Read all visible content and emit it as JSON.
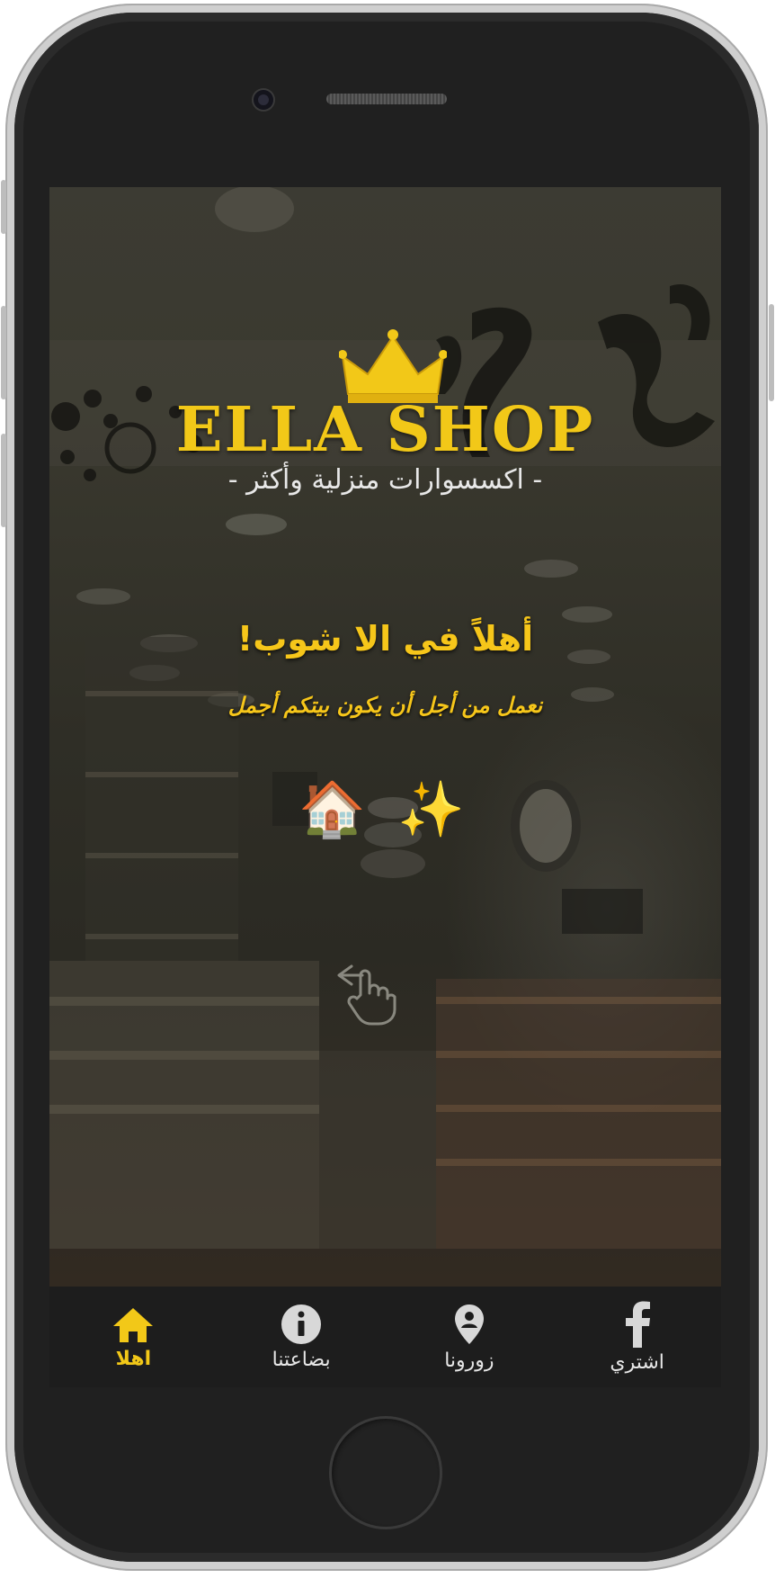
{
  "branding": {
    "logo_text": "ELLA SHOP",
    "tagline": "- اكسسوارات منزلية وأكثر -"
  },
  "hero": {
    "welcome": "أهلاً في الا شوب!",
    "motto": "نعمل من أجل أن يكون بيتكم أجمل",
    "emojis": "🏠 ✨"
  },
  "icons": {
    "swipe": "swipe-hand-icon",
    "crown": "crown-icon"
  },
  "tabbar": {
    "tabs": [
      {
        "label": "اهلا",
        "icon": "home-icon",
        "active": true
      },
      {
        "label": "بضاعتنا",
        "icon": "info-icon",
        "active": false
      },
      {
        "label": "زورونا",
        "icon": "location-pin-icon",
        "active": false
      },
      {
        "label": "اشتري",
        "icon": "facebook-icon",
        "active": false
      }
    ]
  },
  "colors": {
    "accent": "#f2c818",
    "tabbar_bg": "#1d1d1d",
    "inactive_icon": "#d8d8d8"
  }
}
